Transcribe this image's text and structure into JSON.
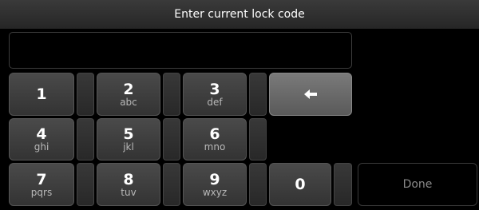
{
  "title": "Enter current lock code",
  "keys": [
    {
      "num": "1",
      "sub": ""
    },
    {
      "num": "2",
      "sub": "abc"
    },
    {
      "num": "3",
      "sub": "def"
    },
    {
      "num": "4",
      "sub": "ghi"
    },
    {
      "num": "5",
      "sub": "jkl"
    },
    {
      "num": "6",
      "sub": "mno"
    },
    {
      "num": "7",
      "sub": "pqrs"
    },
    {
      "num": "8",
      "sub": "tuv"
    },
    {
      "num": "9",
      "sub": "wxyz"
    },
    {
      "num": "0",
      "sub": ""
    }
  ],
  "done_label": "Done",
  "backspace_icon": "left-arrow-icon"
}
